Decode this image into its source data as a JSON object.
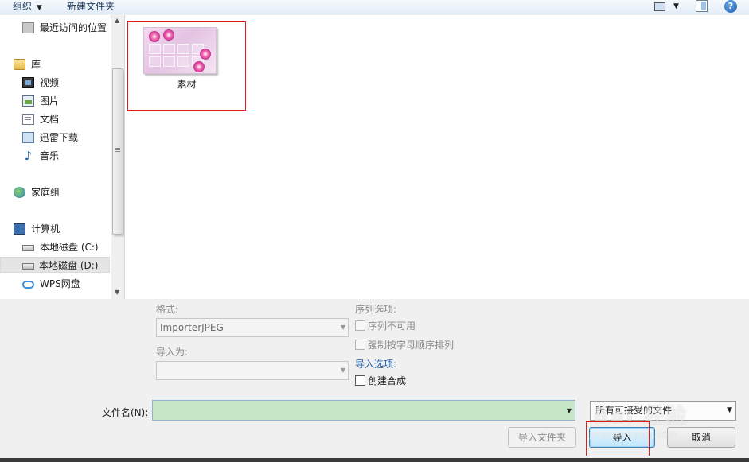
{
  "toolbar": {
    "organize_label": "组织",
    "new_folder_label": "新建文件夹",
    "help_label": "?"
  },
  "nav": {
    "recent": "最近访问的位置",
    "libraries": "库",
    "videos": "视频",
    "pictures": "图片",
    "documents": "文档",
    "thunder_downloads": "迅雷下载",
    "music": "音乐",
    "homegroup": "家庭组",
    "computer": "计算机",
    "drive_c": "本地磁盘 (C:)",
    "drive_d": "本地磁盘 (D:)",
    "wps_cloud": "WPS网盘"
  },
  "files": [
    {
      "name": "素材"
    }
  ],
  "options": {
    "format_label": "格式:",
    "format_value": "ImporterJPEG",
    "import_as_label": "导入为:",
    "import_as_value": "",
    "sequence_options_label": "序列选项:",
    "sequence_unavailable": "序列不可用",
    "force_alpha_order": "强制按字母顺序排列",
    "import_options_label": "导入选项:",
    "create_composition": "创建合成"
  },
  "file_name": {
    "label": "文件名(N):",
    "value": ""
  },
  "file_type": {
    "value": "所有可接受的文件"
  },
  "buttons": {
    "import_folder": "导入文件夹",
    "import": "导入",
    "cancel": "取消"
  },
  "watermark": {
    "brand": "Bai 经验",
    "url": "jingyan.baidu.com"
  }
}
